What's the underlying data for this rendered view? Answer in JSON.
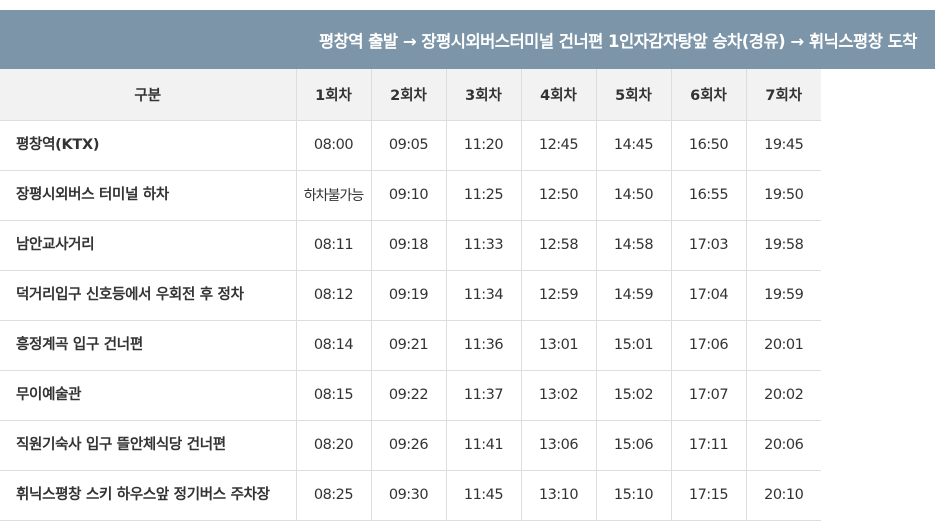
{
  "header": {
    "route_title": "평창역 출발 → 장평시외버스터미널 건너편 1인자감자탕앞 승차(경유) → 휘닉스평창 도착"
  },
  "table": {
    "header_label": "구분",
    "trips": [
      "1회차",
      "2회차",
      "3회차",
      "4회차",
      "5회차",
      "6회차",
      "7회차"
    ],
    "rows": [
      {
        "stop": "평창역(KTX)",
        "times": [
          "08:00",
          "09:05",
          "11:20",
          "12:45",
          "14:45",
          "16:50",
          "19:45"
        ]
      },
      {
        "stop": "장평시외버스 터미널 하차",
        "times": [
          "하차불가능",
          "09:10",
          "11:25",
          "12:50",
          "14:50",
          "16:55",
          "19:50"
        ]
      },
      {
        "stop": "남안교사거리",
        "times": [
          "08:11",
          "09:18",
          "11:33",
          "12:58",
          "14:58",
          "17:03",
          "19:58"
        ]
      },
      {
        "stop": "덕거리입구 신호등에서 우회전 후 정차",
        "times": [
          "08:12",
          "09:19",
          "11:34",
          "12:59",
          "14:59",
          "17:04",
          "19:59"
        ]
      },
      {
        "stop": "흥정계곡 입구 건너편",
        "times": [
          "08:14",
          "09:21",
          "11:36",
          "13:01",
          "15:01",
          "17:06",
          "20:01"
        ]
      },
      {
        "stop": "무이예술관",
        "times": [
          "08:15",
          "09:22",
          "11:37",
          "13:02",
          "15:02",
          "17:07",
          "20:02"
        ]
      },
      {
        "stop": "직원기숙사 입구 뜰안체식당 건너편",
        "times": [
          "08:20",
          "09:26",
          "11:41",
          "13:06",
          "15:06",
          "17:11",
          "20:06"
        ]
      },
      {
        "stop": "휘닉스평창 스키 하우스앞 정기버스 주차장",
        "times": [
          "08:25",
          "09:30",
          "11:45",
          "13:10",
          "15:10",
          "17:15",
          "20:10"
        ]
      }
    ]
  },
  "colors": {
    "banner_bg": "#7c95a8",
    "header_row_bg": "#f2f2f2",
    "border": "#dddddd",
    "text": "#333333"
  }
}
